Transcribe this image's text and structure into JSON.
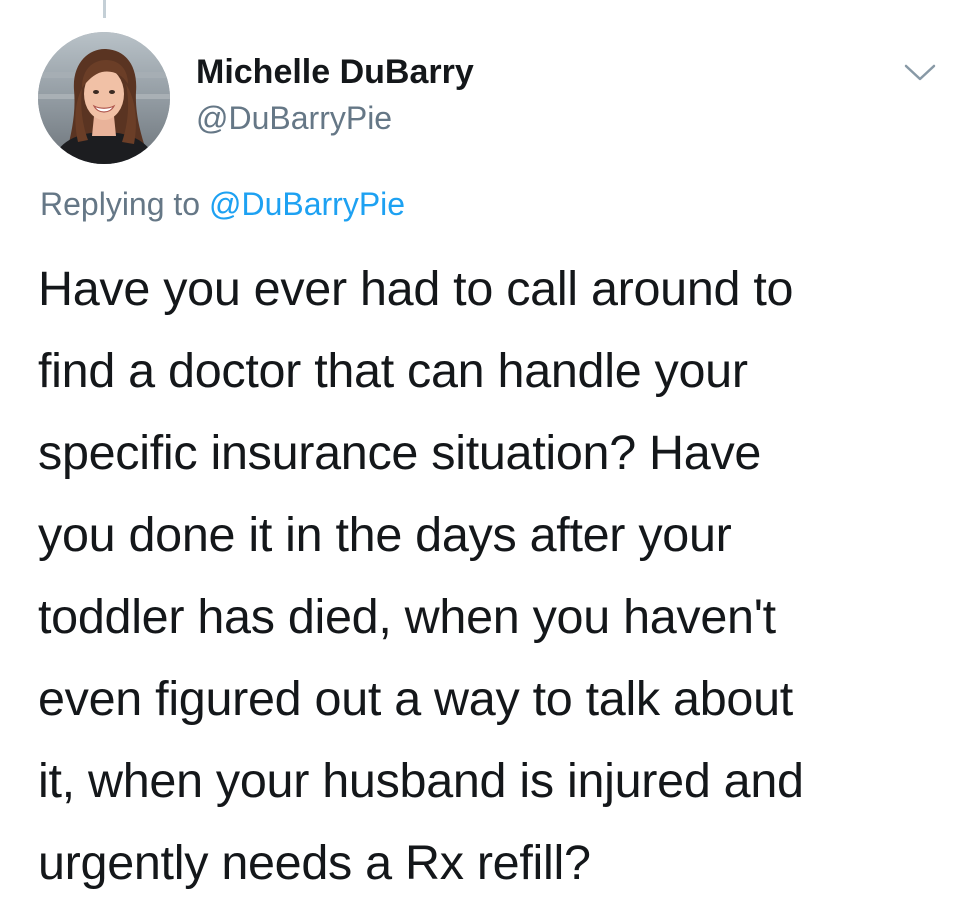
{
  "author": {
    "display_name": "Michelle DuBarry",
    "handle": "@DuBarryPie"
  },
  "reply_context": {
    "prefix": "Replying to",
    "mention": "@DuBarryPie"
  },
  "tweet": {
    "lines": [
      "Have you ever had to call around to",
      "find a doctor that can handle your",
      "specific insurance situation? Have",
      "you done it in the days after your",
      "toddler has died, when you haven't",
      "even figured out a way to talk about",
      "it, when your husband is injured and",
      "urgently needs a Rx refill?"
    ]
  },
  "icons": {
    "more_menu": "chevron-down-icon",
    "avatar": "profile-photo"
  },
  "colors": {
    "text_primary": "#14171a",
    "text_secondary": "#657786",
    "link": "#1da1f2",
    "thread_line": "#c4cfd6"
  }
}
